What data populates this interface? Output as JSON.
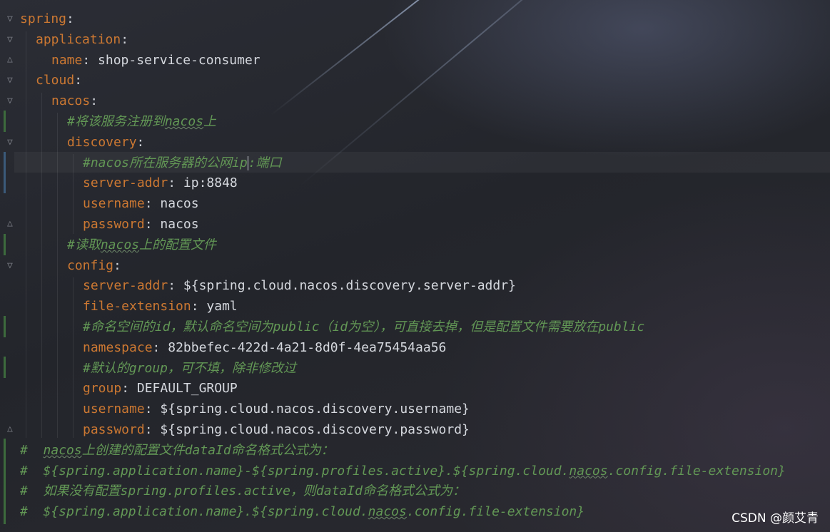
{
  "lines": [
    {
      "key": "spring",
      "sep": ":"
    },
    {
      "key": "application",
      "sep": ":"
    },
    {
      "key": "name",
      "sep": ": ",
      "value": "shop-service-consumer"
    },
    {
      "key": "cloud",
      "sep": ":"
    },
    {
      "key": "nacos",
      "sep": ":"
    },
    {
      "comment_a": "#将该服务注册到",
      "comment_word": "nacos",
      "comment_b": "上"
    },
    {
      "key": "discovery",
      "sep": ":"
    },
    {
      "comment_a": "#nacos所在服务器的公网ip",
      "comment_b": ":端口"
    },
    {
      "key": "server-addr",
      "sep": ": ",
      "value": "ip:8848"
    },
    {
      "key": "username",
      "sep": ": ",
      "value": "nacos"
    },
    {
      "key": "password",
      "sep": ": ",
      "value": "nacos"
    },
    {
      "comment_a": "#读取",
      "comment_word": "nacos",
      "comment_b": "上的配置文件"
    },
    {
      "key": "config",
      "sep": ":"
    },
    {
      "key": "server-addr",
      "sep": ": ",
      "value": "${spring.cloud.nacos.discovery.server-addr}"
    },
    {
      "key": "file-extension",
      "sep": ": ",
      "value": "yaml"
    },
    {
      "comment_a": "#命名空间的id，默认命名空间为public（id为空），可直接去掉，但是配置文件需要放在public"
    },
    {
      "key": "namespace",
      "sep": ": ",
      "value": "82bbefec-422d-4a21-8d0f-4ea75454aa56"
    },
    {
      "comment_a": "#默认的group，可不填，除非修改过"
    },
    {
      "key": "group",
      "sep": ": ",
      "value": "DEFAULT_GROUP"
    },
    {
      "key": "username",
      "sep": ": ",
      "value": "${spring.cloud.nacos.discovery.username}"
    },
    {
      "key": "password",
      "sep": ": ",
      "value": "${spring.cloud.nacos.discovery.password}"
    },
    {
      "comment_a": "#  ",
      "comment_word": "nacos",
      "comment_b": "上创建的配置文件dataId命名格式公式为："
    },
    {
      "comment_a": "#  ${spring.application.name}-${spring.profiles.active}.${spring.cloud.",
      "comment_word": "nacos",
      "comment_b": ".config.file-extension}"
    },
    {
      "comment_a": "#  如果没有配置spring.profiles.active，则dataId命名格式公式为："
    },
    {
      "comment_a": "#  ${spring.application.name}.${spring.cloud.",
      "comment_word": "nacos",
      "comment_b": ".config.file-extension}"
    }
  ],
  "watermark": "CSDN @颜艾青",
  "colors": {
    "key": "#cc7832",
    "comment": "#629755",
    "value": "#d5d8de",
    "background": "#24262c"
  },
  "icons": [
    "fold-open-icon",
    "fold-close-icon"
  ]
}
